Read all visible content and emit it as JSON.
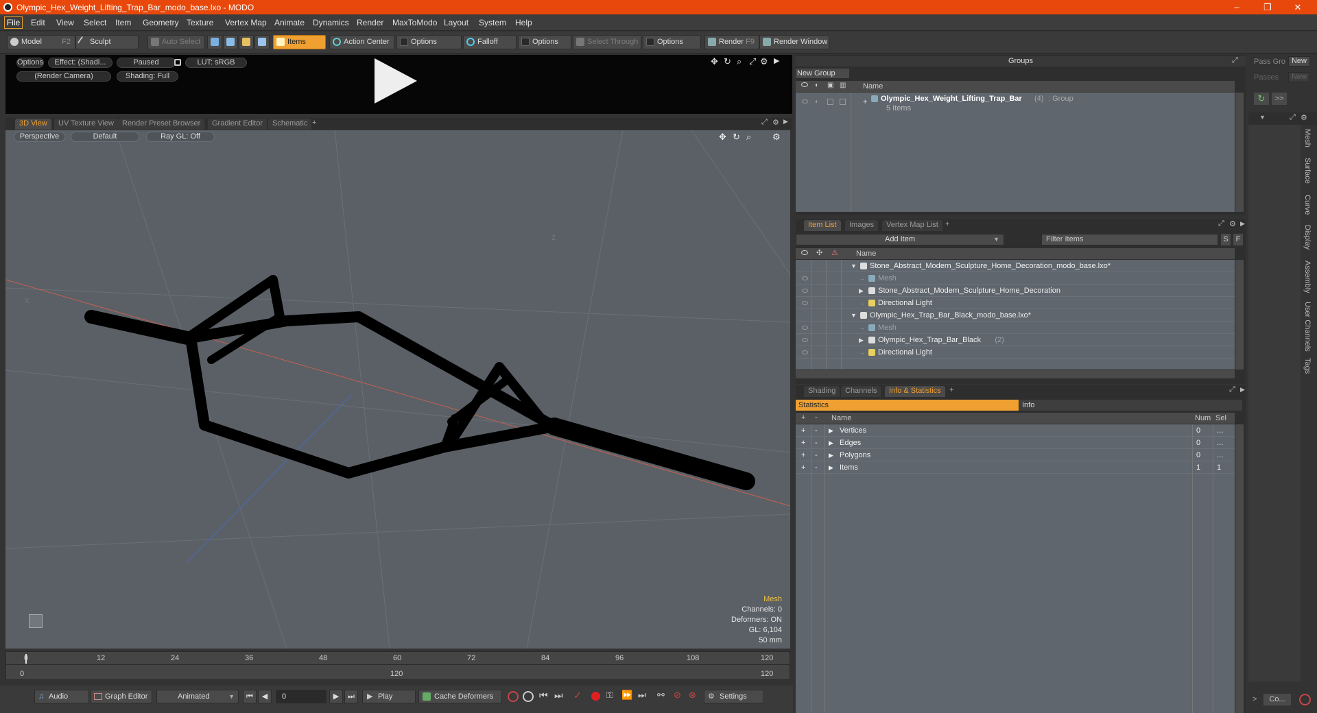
{
  "window": {
    "title": "Olympic_Hex_Weight_Lifting_Trap_Bar_modo_base.lxo - MODO",
    "minimize": "–",
    "maximize": "❐",
    "close": "✕"
  },
  "menu": [
    "File",
    "Edit",
    "View",
    "Select",
    "Item",
    "Geometry",
    "Texture",
    "Vertex Map",
    "Animate",
    "Dynamics",
    "Render",
    "MaxToModo",
    "Layout",
    "System",
    "Help"
  ],
  "toolbar": {
    "model": "Model",
    "model_key": "F2",
    "sculpt": "Sculpt",
    "auto_select": "Auto Select",
    "items": "Items",
    "action_center": "Action Center",
    "options1": "Options",
    "falloff": "Falloff",
    "options2": "Options",
    "select_through": "Select Through",
    "options3": "Options",
    "render": "Render",
    "render_key": "F9",
    "render_window": "Render Window"
  },
  "viewer": {
    "options": "Options",
    "effect": "Effect: (Shadi...",
    "paused": "Paused",
    "lut": "LUT: sRGB",
    "camera": "(Render Camera)",
    "shading": "Shading: Full"
  },
  "view_tabs": [
    "3D View",
    "UV Texture View",
    "Render Preset Browser",
    "Gradient Editor",
    "Schematic"
  ],
  "viewport": {
    "perspective": "Perspective",
    "default": "Default",
    "raygl": "Ray GL: Off",
    "axis_z": "Z",
    "axis_x": "X",
    "hud": {
      "type": "Mesh",
      "channels": "Channels: 0",
      "deformers": "Deformers: ON",
      "gl": "GL: 6,104",
      "size": "50 mm"
    }
  },
  "timeline": {
    "ticks": [
      "0",
      "12",
      "24",
      "36",
      "48",
      "60",
      "72",
      "84",
      "96",
      "108",
      "120"
    ],
    "sub_left": "0",
    "sub_mid": "120",
    "sub_right": "120"
  },
  "bottom": {
    "audio": "Audio",
    "graph_editor": "Graph Editor",
    "animated": "Animated",
    "frame": "0",
    "play": "Play",
    "cache_deformers": "Cache Deformers",
    "settings": "Settings"
  },
  "groups": {
    "title": "Groups",
    "new_group": "New Group",
    "col_name": "Name",
    "item_name": "Olympic_Hex_Weight_Lifting_Trap_Bar",
    "item_count": "(4)",
    "item_type": ": Group",
    "item_sub": "5 Items"
  },
  "pass": {
    "pass_gro": "Pass Gro",
    "new1": "New",
    "passes": "Passes",
    "new2": "New",
    "more": ">>"
  },
  "item_tabs": [
    "Item List",
    "Images",
    "Vertex Map List"
  ],
  "itemlist": {
    "add_item": "Add Item",
    "filter": "Filter Items",
    "s": "S",
    "f": "F",
    "col_name": "Name",
    "rows": [
      {
        "label": "Stone_Abstract_Modern_Sculpture_Home_Decoration_modo_base.lxo*",
        "indent": 0,
        "kind": "scene",
        "arrow": "▼"
      },
      {
        "label": "Mesh",
        "indent": 1,
        "kind": "mesh",
        "arrow": ""
      },
      {
        "label": "Stone_Abstract_Modern_Sculpture_Home_Decoration",
        "indent": 1,
        "kind": "loc",
        "arrow": "▶"
      },
      {
        "label": "Directional Light",
        "indent": 1,
        "kind": "light",
        "arrow": ""
      },
      {
        "label": "Olympic_Hex_Trap_Bar_Black_modo_base.lxo*",
        "indent": 0,
        "kind": "scene",
        "arrow": "▼"
      },
      {
        "label": "Mesh",
        "indent": 1,
        "kind": "mesh",
        "arrow": ""
      },
      {
        "label": "Olympic_Hex_Trap_Bar_Black",
        "indent": 1,
        "kind": "loc",
        "arrow": "▶",
        "count": "(2)"
      },
      {
        "label": "Directional Light",
        "indent": 1,
        "kind": "light",
        "arrow": ""
      }
    ]
  },
  "stats_tabs": [
    "Shading",
    "Channels",
    "Info & Statistics"
  ],
  "stats": {
    "statistics": "Statistics",
    "info": "Info",
    "col_name": "Name",
    "col_num": "Num",
    "col_sel": "Sel",
    "rows": [
      {
        "name": "Vertices",
        "num": "0",
        "sel": "..."
      },
      {
        "name": "Edges",
        "num": "0",
        "sel": "..."
      },
      {
        "name": "Polygons",
        "num": "0",
        "sel": "..."
      },
      {
        "name": "Items",
        "num": "1",
        "sel": "1"
      }
    ]
  },
  "side_tabs": [
    "Mesh",
    "Surface",
    "Curve",
    "Display",
    "Assembly",
    "User Channels",
    "Tags"
  ],
  "bottom_right": {
    "co": "Co...",
    "arrow": ">"
  }
}
